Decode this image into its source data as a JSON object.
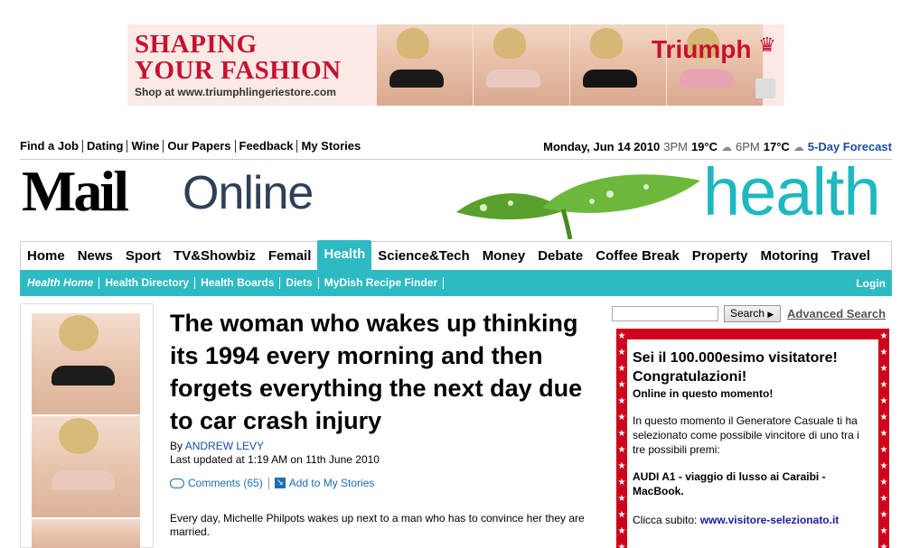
{
  "banner": {
    "headline_line1": "SHAPING",
    "headline_line2": "YOUR FASHION",
    "shop_text": "Shop at www.triumphlingeriestore.com",
    "brand": "Triumph"
  },
  "utility": {
    "links": [
      "Find a Job",
      "Dating",
      "Wine",
      "Our Papers",
      "Feedback",
      "My Stories"
    ],
    "date": "Monday, Jun 14 2010",
    "time1": "3PM",
    "temp1": "19°C",
    "time2": "6PM",
    "temp2": "17°C",
    "forecast_link": "5-Day Forecast"
  },
  "masthead": {
    "logo_bold": "Mail",
    "logo_light": "Online",
    "section": "health"
  },
  "nav": {
    "items": [
      "Home",
      "News",
      "Sport",
      "TV&Showbiz",
      "Femail",
      "Health",
      "Science&Tech",
      "Money",
      "Debate",
      "Coffee Break",
      "Property",
      "Motoring",
      "Travel"
    ],
    "active": "Health"
  },
  "subnav": {
    "items": [
      "Health Home",
      "Health Directory",
      "Health Boards",
      "Diets",
      "MyDish Recipe Finder"
    ],
    "login": "Login"
  },
  "search": {
    "button_label": "Search",
    "advanced_label": "Advanced Search",
    "input_value": ""
  },
  "article": {
    "headline": "The woman who wakes up thinking its 1994 every morning and then forgets everything the next day due to car crash injury",
    "by_prefix": "By",
    "author": "ANDREW LEVY",
    "updated": "Last updated at 1:19 AM on 11th June 2010",
    "comments": "Comments (65)",
    "add_to": "Add to My Stories",
    "intro": "Every day, Michelle Philpots wakes up next to a man who has to convince her they are married."
  },
  "popup": {
    "title1": "Sei il 100.000esimo visitatore!",
    "title2": "Congratulazioni!",
    "online": "Online in questo momento!",
    "paragraph": "In questo momento il Generatore Casuale ti ha selezionato come possibile vincitore di uno tra i tre possibili premi:",
    "prizes": "AUDI A1 -  viaggio di lusso ai Caraibi - MacBook.",
    "cta_prefix": "Clicca subito:",
    "cta_link": "www.visitore-selezionato.it"
  }
}
